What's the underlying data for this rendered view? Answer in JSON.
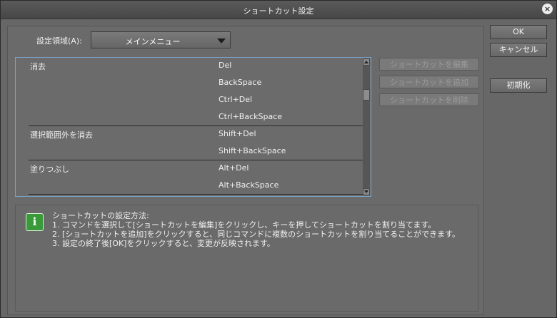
{
  "dialog": {
    "title": "ショートカット設定",
    "close_glyph": "×"
  },
  "area": {
    "label": "設定領域(A):",
    "value": "メインメニュー"
  },
  "shortcuts": [
    {
      "command": "消去",
      "keys": [
        "Del",
        "BackSpace",
        "Ctrl+Del",
        "Ctrl+BackSpace"
      ]
    },
    {
      "command": "選択範囲外を消去",
      "keys": [
        "Shift+Del",
        "Shift+BackSpace"
      ]
    },
    {
      "command": "塗りつぶし",
      "keys": [
        "Alt+Del",
        "Alt+BackSpace"
      ]
    }
  ],
  "side_buttons": {
    "edit": "ショートカットを編集",
    "add": "ショートカットを追加",
    "delete": "ショートカットを削除"
  },
  "dialog_buttons": {
    "ok": "OK",
    "cancel": "キャンセル",
    "reset": "初期化"
  },
  "info": {
    "icon_glyph": "i",
    "heading": "ショートカットの設定方法:",
    "lines": [
      "1. コマンドを選択して[ショートカットを編集]をクリックし、キーを押してショートカットを割り当てます。",
      "2. [ショートカットを追加]をクリックすると、同じコマンドに複数のショートカットを割り当てることができます。",
      "3. 設定の終了後[OK]をクリックすると、変更が反映されます。"
    ]
  }
}
